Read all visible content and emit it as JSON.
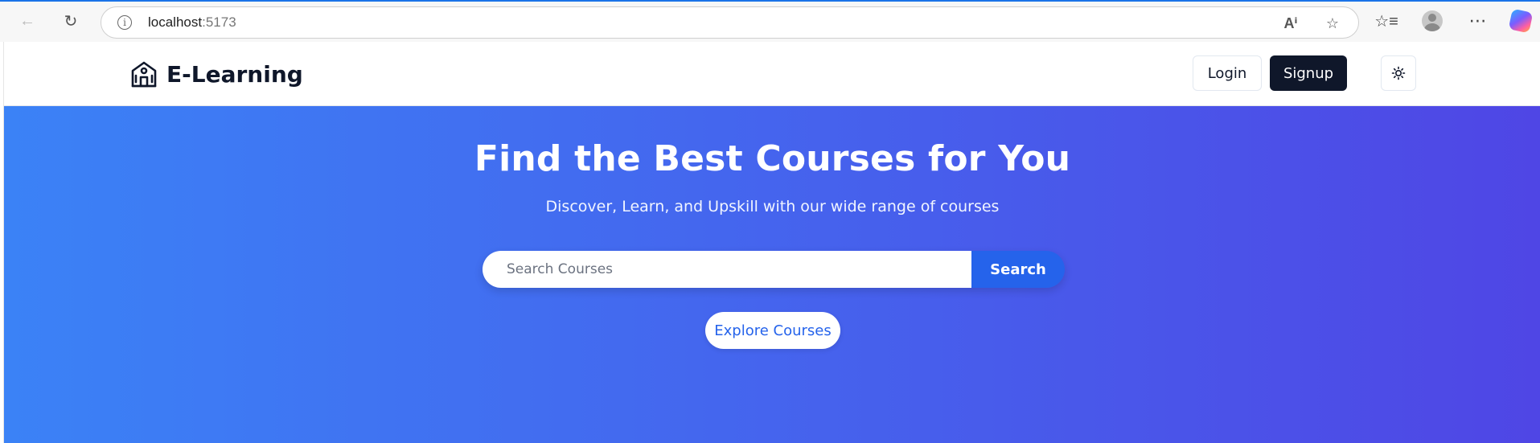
{
  "browser": {
    "url_host": "localhost",
    "url_port": ":5173",
    "icons": {
      "back": "arrow-left-icon",
      "reload": "reload-icon",
      "info": "info-icon",
      "read_aloud": "read-aloud-icon",
      "favorite": "star-icon",
      "favorites": "favorites-list-icon",
      "profile": "profile-avatar-icon",
      "more": "more-dots-icon",
      "copilot": "copilot-icon"
    }
  },
  "header": {
    "brand_name": "E-Learning",
    "brand_icon": "school-building-icon",
    "login_label": "Login",
    "signup_label": "Signup",
    "theme_icon": "sun-icon"
  },
  "hero": {
    "title": "Find the Best Courses for You",
    "subtitle": "Discover, Learn, and Upskill with our wide range of courses",
    "search_placeholder": "Search Courses",
    "search_value": "",
    "search_button": "Search",
    "explore_button": "Explore Courses"
  },
  "colors": {
    "gradient_start": "#3b82f6",
    "gradient_end": "#4f46e5",
    "primary_dark": "#0f172a",
    "accent_blue": "#2563eb"
  }
}
